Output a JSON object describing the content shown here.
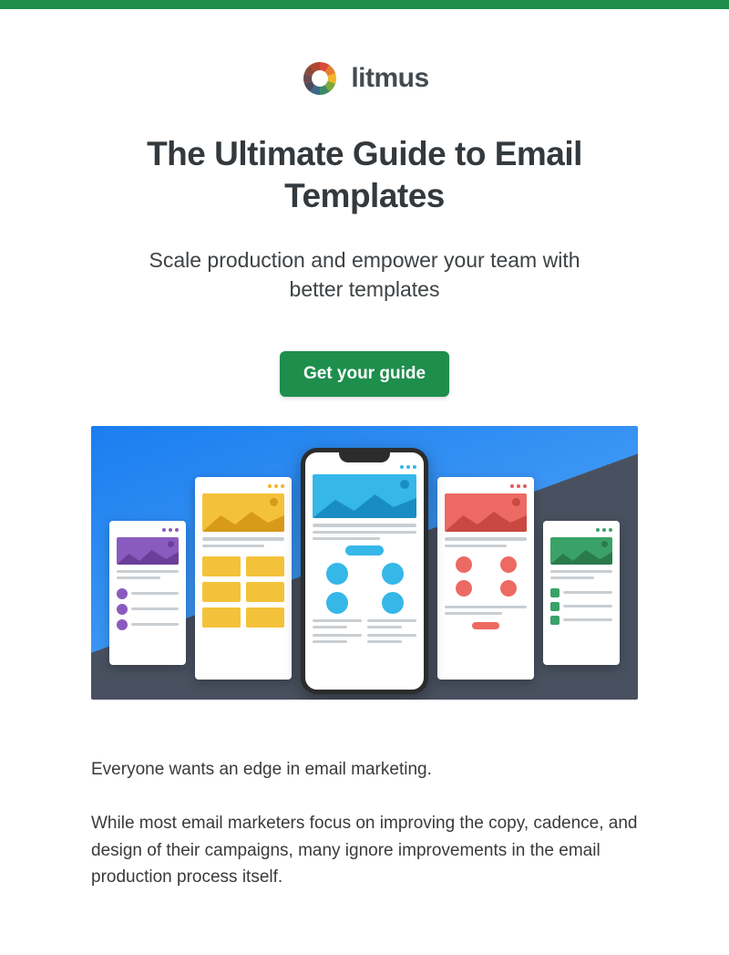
{
  "brand": {
    "name": "litmus",
    "accent": "#1e8e4c"
  },
  "hero": {
    "title": "The Ultimate Guide to Email Templates",
    "subtitle": "Scale production and empower your team with better templates",
    "cta_label": "Get your guide"
  },
  "body": {
    "p1": "Everyone wants an edge in email marketing.",
    "p2": "While most email marketers focus on improving the copy, cadence, and design of their campaigns, many ignore improvements in the email production process itself."
  }
}
